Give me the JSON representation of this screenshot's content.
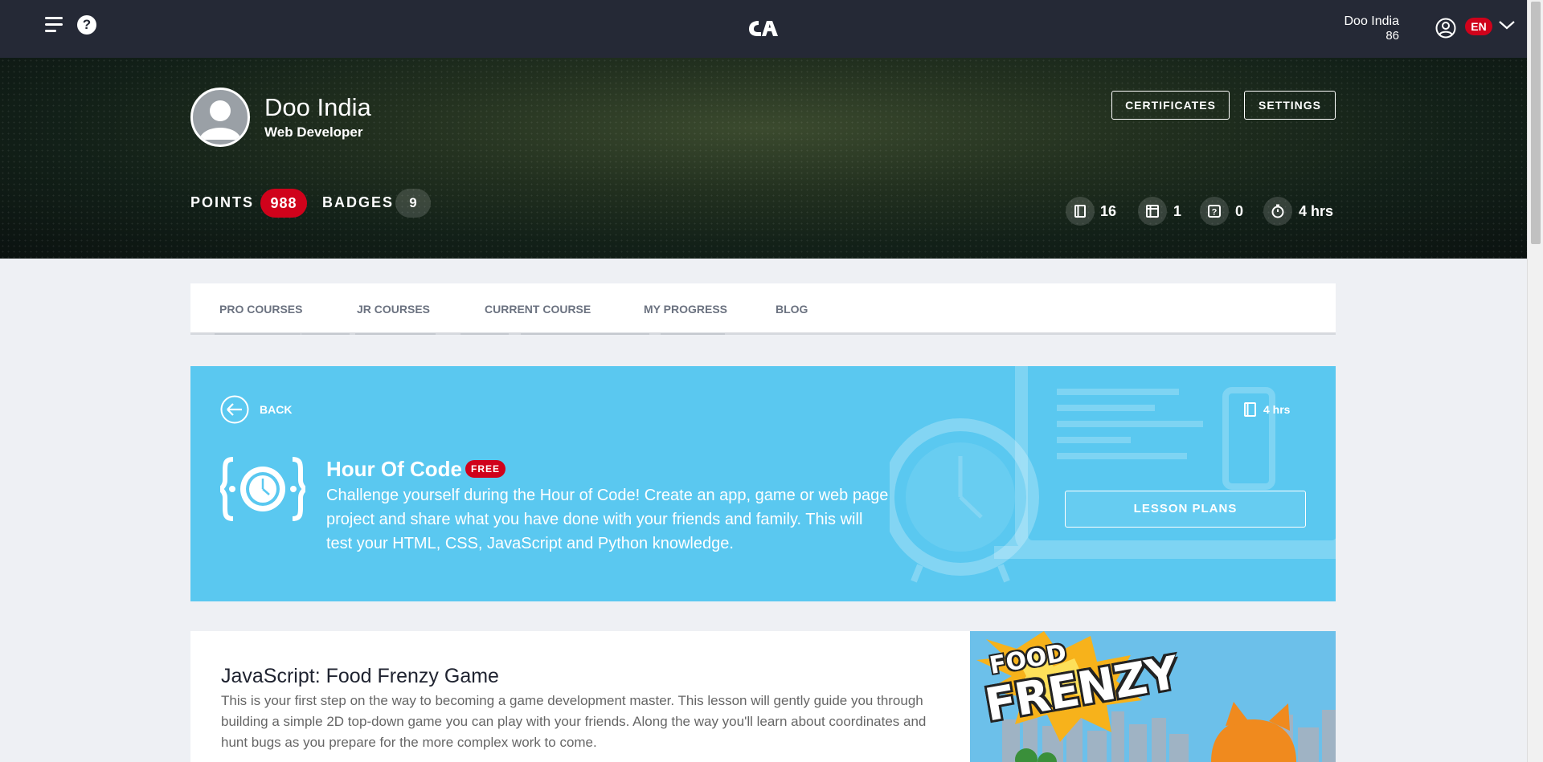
{
  "topbar": {
    "user_name": "Doo India",
    "user_points": "86",
    "language": "EN"
  },
  "profile": {
    "name": "Doo India",
    "role": "Web Developer",
    "certificates_label": "CERTIFICATES",
    "settings_label": "SETTINGS",
    "points_label": "POINTS",
    "points_value": "988",
    "badges_label": "BADGES",
    "badges_value": "9",
    "stats": [
      {
        "icon": "book-icon",
        "value": "16"
      },
      {
        "icon": "layout-icon",
        "value": "1"
      },
      {
        "icon": "question-icon",
        "value": "0"
      },
      {
        "icon": "stopwatch-icon",
        "value": "4 hrs"
      }
    ]
  },
  "tabs": [
    {
      "label": "PRO COURSES"
    },
    {
      "label": "JR COURSES"
    },
    {
      "label": "CURRENT COURSE"
    },
    {
      "label": "MY PROGRESS"
    },
    {
      "label": "BLOG"
    }
  ],
  "course": {
    "back_label": "BACK",
    "duration": "4 hrs",
    "title": "Hour Of Code",
    "badge": "FREE",
    "description": "Challenge yourself during the Hour of Code! Create an app, game or web page project and share what you have done with your friends and family. This will test your HTML, CSS, JavaScript and Python knowledge.",
    "lesson_plans_label": "LESSON PLANS"
  },
  "lesson": {
    "title": "JavaScript: Food Frenzy Game",
    "description": "This is your first step on the way to becoming a game development master. This lesson will gently guide you through building a simple 2D top-down game you can play with your friends. Along the way you'll learn about coordinates and hunt bugs as you prepare for the more complex work to come.",
    "image_text_1": "FOOD",
    "image_text_2": "FRENZY"
  },
  "colors": {
    "topbar": "#252936",
    "accent_red": "#d0021b",
    "banner_blue": "#5ac8f0"
  }
}
